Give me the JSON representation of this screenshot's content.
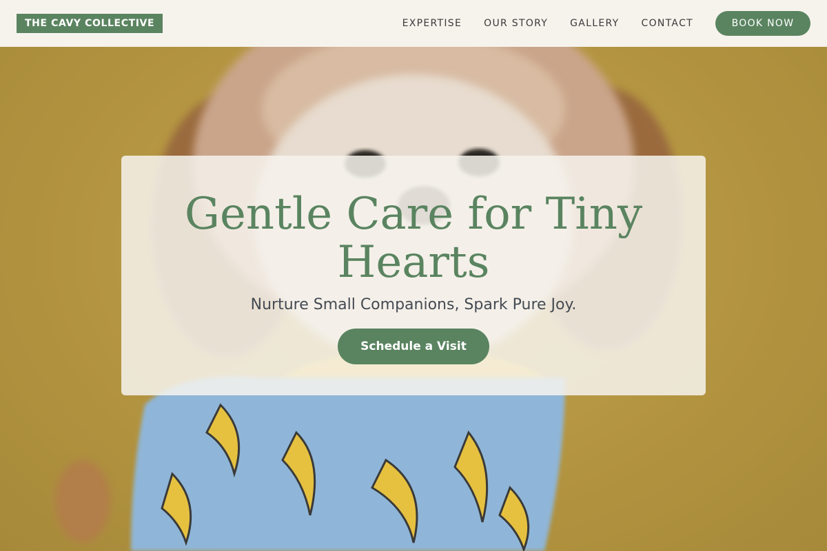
{
  "brand": {
    "name": "THE CAVY COLLECTIVE"
  },
  "nav": {
    "links": [
      "EXPERTISE",
      "OUR STORY",
      "GALLERY",
      "CONTACT"
    ],
    "cta_label": "BOOK NOW"
  },
  "hero": {
    "headline": "Gentle Care for Tiny Hearts",
    "subheadline": "Nurture Small Companions, Spark Pure Joy.",
    "cta_label": "Schedule a Visit"
  },
  "colors": {
    "accent": "#5a8460",
    "header_bg": "#f6f3ed",
    "hero_bg": "#b69848"
  }
}
